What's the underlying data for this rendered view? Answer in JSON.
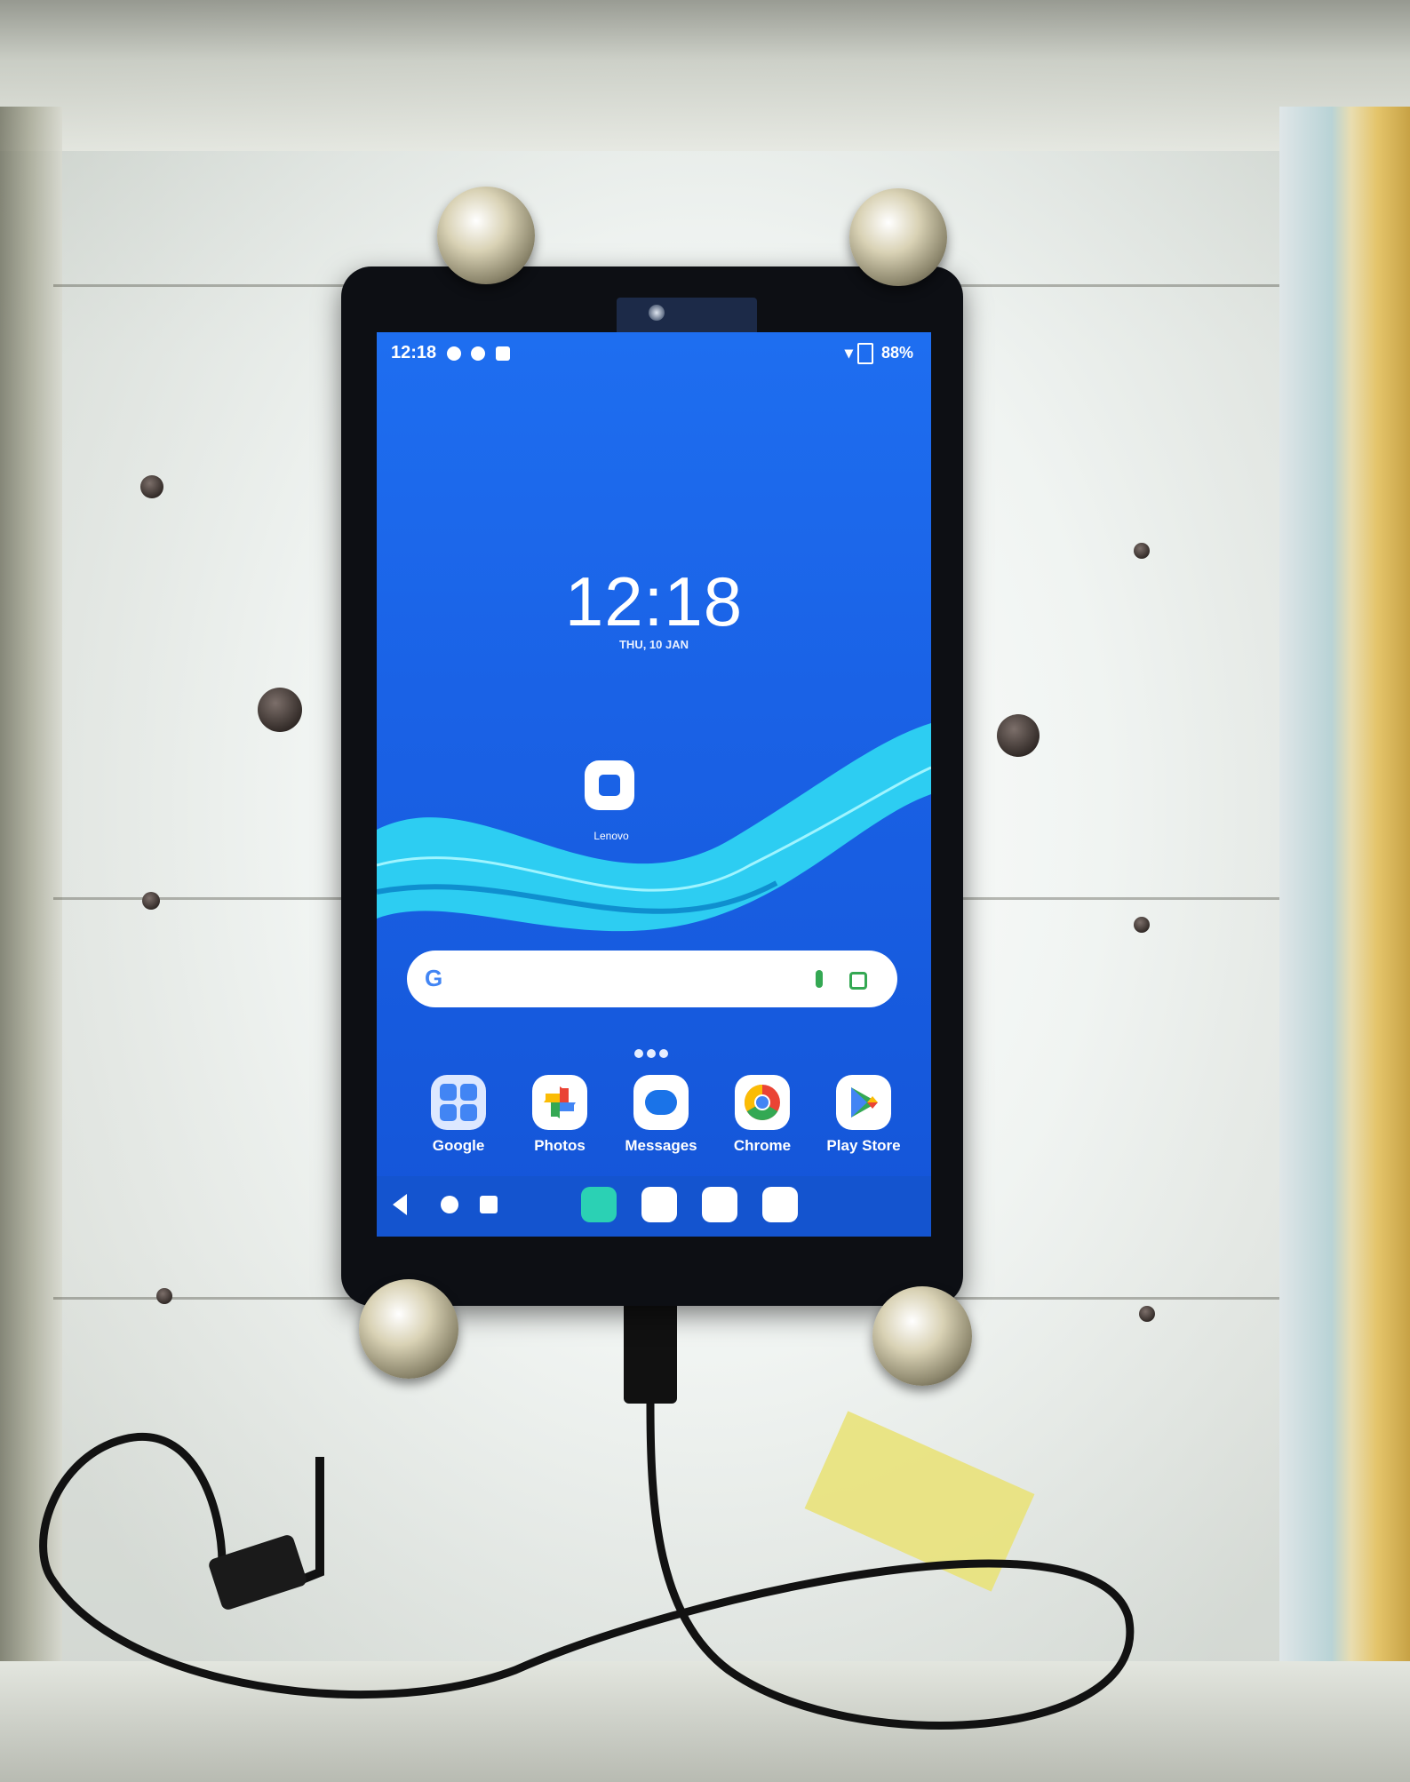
{
  "status_bar": {
    "time": "12:18",
    "battery": "88%"
  },
  "lockscreen": {
    "clock": "12:18",
    "date": "THU, 10 JAN"
  },
  "home": {
    "standalone_app": {
      "label": "Lenovo",
      "icon": "lenovo-bag-icon"
    },
    "search": {
      "logo": "G",
      "icons": [
        "mic-icon",
        "lens-icon"
      ]
    },
    "dock": [
      {
        "label": "Google",
        "icon": "google-folder-icon"
      },
      {
        "label": "Photos",
        "icon": "photos-pinwheel-icon"
      },
      {
        "label": "Messages",
        "icon": "messages-bubble-icon"
      },
      {
        "label": "Chrome",
        "icon": "chrome-icon"
      },
      {
        "label": "Play Store",
        "icon": "play-store-icon"
      }
    ],
    "taskbar_icons": [
      "settings-icon",
      "app-icon",
      "gallery-icon",
      "camera-icon"
    ],
    "nav_icons": [
      "back-icon",
      "home-icon",
      "recents-icon"
    ]
  },
  "colors": {
    "screen_blue": "#1A62E6",
    "wave_cyan": "#2ED3F2",
    "bezel": "#0D0F14"
  }
}
